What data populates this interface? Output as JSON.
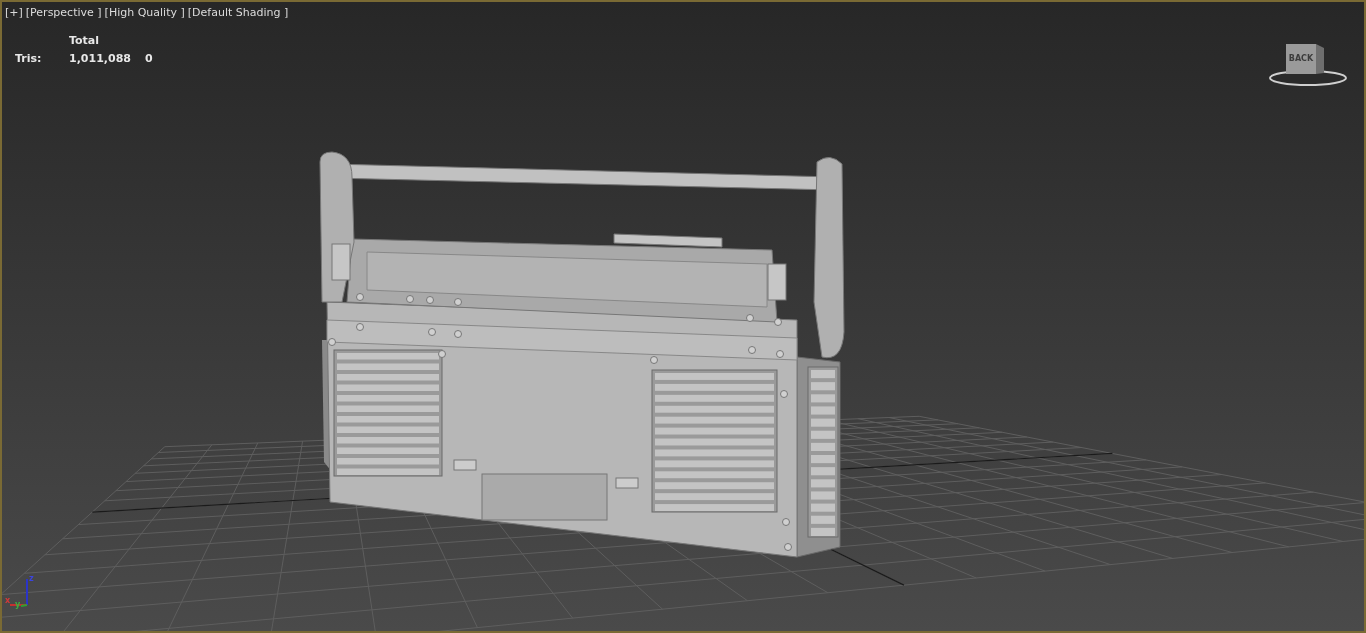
{
  "viewport": {
    "labels": [
      "[+]",
      "[Perspective ]",
      "[High Quality ]",
      "[Default Shading ]"
    ],
    "stats": {
      "column_header": "Total",
      "rows": [
        {
          "label": "Tris:",
          "values": [
            "1,011,088",
            "0"
          ]
        }
      ]
    },
    "viewcube": {
      "face_label": "BACK"
    },
    "axis_gizmo": {
      "axes": [
        "z",
        "x",
        "y"
      ]
    }
  }
}
